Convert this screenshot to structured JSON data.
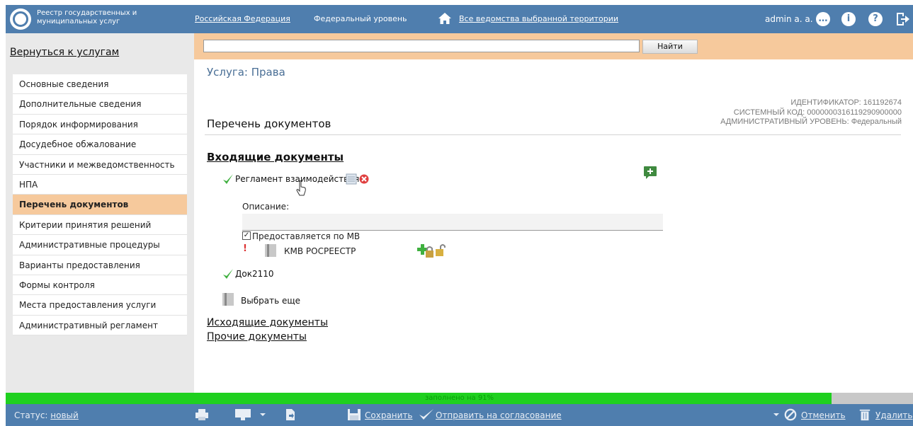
{
  "header": {
    "app_name": "Реестр государственных и муниципальных услуг",
    "region": "Российская Федерация",
    "level": "Федеральный уровень",
    "agencies": "Все ведомства выбранной территории",
    "user": "admin a. a."
  },
  "sidebar": {
    "back_link": "Вернуться к услугам",
    "items": [
      {
        "label": "Основные сведения"
      },
      {
        "label": "Дополнительные сведения"
      },
      {
        "label": "Порядок информирования"
      },
      {
        "label": "Досудебное обжалование"
      },
      {
        "label": "Участники и межведомственность"
      },
      {
        "label": "НПА"
      },
      {
        "label": "Перечень документов"
      },
      {
        "label": "Критерии принятия решений"
      },
      {
        "label": "Административные процедуры"
      },
      {
        "label": "Варианты предоставления"
      },
      {
        "label": "Формы контроля"
      },
      {
        "label": "Места предоставления услуги"
      },
      {
        "label": "Административный регламент"
      }
    ],
    "active_item": "Перечень документов"
  },
  "search": {
    "value": "",
    "button_label": "Найти"
  },
  "main": {
    "service_title": "Услуга: Права",
    "meta": {
      "identifier": "ИДЕНТИФИКАТОР: 161192674",
      "system_code": "СИСТЕМНЫЙ КОД: 0000000316119290900000",
      "admin_level": "АДМИНИСТРАТИВНЫЙ УРОВЕНЬ: Федеральный"
    },
    "section_title": "Перечень документов",
    "incoming_title": "Входящие документы",
    "documents": [
      {
        "name": "Регламент взаимодействия"
      },
      {
        "name": "Док2110"
      }
    ],
    "description_label": "Описание:",
    "description_value": "",
    "mv_label": "Предоставляется по МВ",
    "mv_checked": true,
    "mv_required_mark": "!",
    "kmv_label": "КМВ РОСРЕЕСТР",
    "select_more": "Выбрать еще",
    "outgoing_link": "Исходящие документы",
    "other_link": "Прочие документы"
  },
  "progress": {
    "label": "заполнено на 91%",
    "value": 0.91
  },
  "footer": {
    "status_label": "Статус:",
    "status_value": "новый",
    "save": "Сохранить",
    "send": "Отправить на согласование",
    "cancel": "Отменить",
    "delete": "Удалить"
  },
  "colors": {
    "header_bg": "#4f7eae",
    "accent": "#f6c99c",
    "progress": "#1fd01f"
  }
}
